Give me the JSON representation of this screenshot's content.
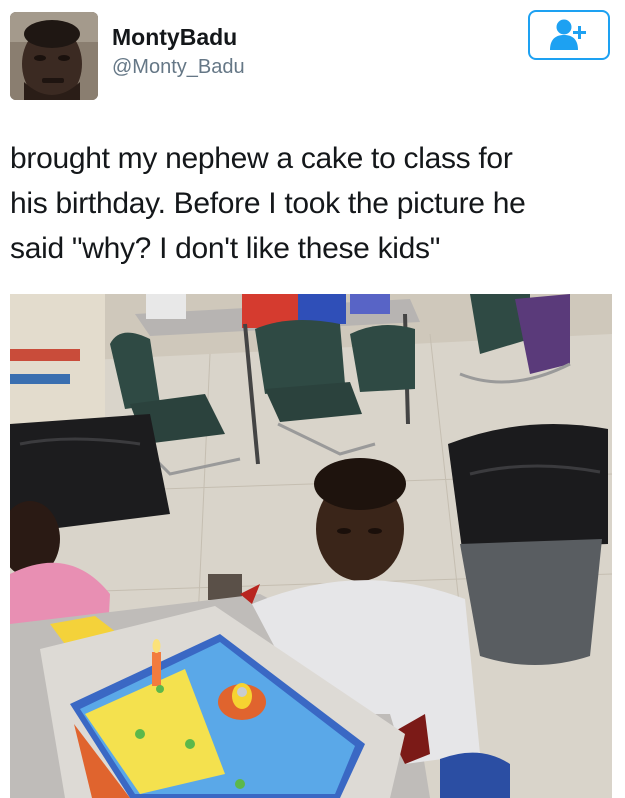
{
  "user": {
    "display_name": "MontyBadu",
    "handle": "@Monty_Badu"
  },
  "follow_button": {
    "icon": "add-user-icon",
    "color": "#1da1f2"
  },
  "tweet": {
    "lines": [
      "brought my nephew a cake to class for",
      "his birthday. Before I took the picture he",
      "said \"why? I don't like these kids\""
    ]
  },
  "colors": {
    "accent": "#1da1f2",
    "handle_gray": "#657786",
    "text": "#14171a"
  }
}
